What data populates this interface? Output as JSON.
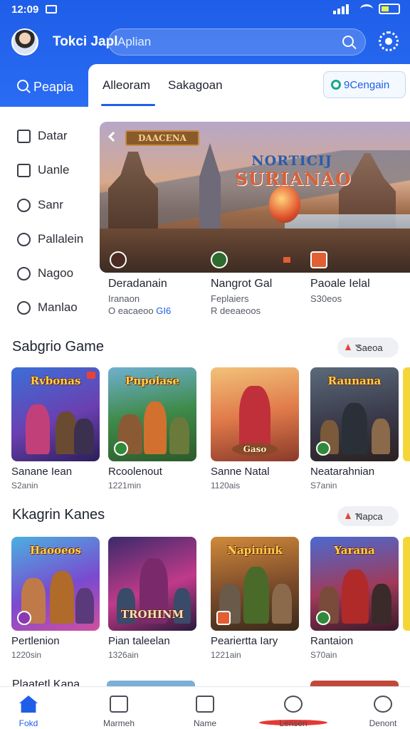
{
  "status_bar": {
    "time": "12:09"
  },
  "header": {
    "app_title": "Tokci Japl",
    "search_placeholder": "Aplian",
    "left_tab": "Peapia",
    "tabs": [
      {
        "label": "Alleoram"
      },
      {
        "label": "Sakagoan"
      }
    ],
    "tab_button": "9Cengain"
  },
  "sidebar": {
    "items": [
      {
        "label": "Datar",
        "icon": "grid-icon"
      },
      {
        "label": "Uanle",
        "icon": "frame-icon"
      },
      {
        "label": "Sanr",
        "icon": "search-icon"
      },
      {
        "label": "Pallalein",
        "icon": "edit-icon"
      },
      {
        "label": "Nagoo",
        "icon": "clock-icon"
      },
      {
        "label": "Manlao",
        "icon": "chat-icon"
      }
    ]
  },
  "featured": {
    "sign": "DAACENA",
    "logo_line1": "NORTICIJ",
    "logo_line2": "SURIANAO",
    "cards": [
      {
        "title": "Deradanain",
        "line1": "Iranaon",
        "line2": "O eacaeoo",
        "highlight": "GI6"
      },
      {
        "title": "Nangrot Gal",
        "line1": "Feplaiers",
        "line2": "R deeaeoos",
        "highlight": ""
      },
      {
        "title": "Paoale Ielal",
        "line1": "S30eos",
        "line2": "",
        "highlight": ""
      }
    ]
  },
  "sections": [
    {
      "title": "Sabgrio Game",
      "pill": "Saeoa",
      "games": [
        {
          "name": "Sanane Iean",
          "meta": "S2anin",
          "art": "Rvbonas"
        },
        {
          "name": "Rcoolenout",
          "meta": "1221min",
          "art": "Pnpolase"
        },
        {
          "name": "Sanne Natal",
          "meta": "1120ais",
          "art": "Gaso"
        },
        {
          "name": "Neatarahnian",
          "meta": "S7anin",
          "art": "Raunana"
        }
      ]
    },
    {
      "title": "Kkagrin Kanes",
      "pill": "Napca",
      "games": [
        {
          "name": "Pertlenion",
          "meta": "1220sin",
          "art": "Haooeos"
        },
        {
          "name": "Pian taleelan",
          "meta": "1326ain",
          "art": "TROHINM"
        },
        {
          "name": "Peariertta Iary",
          "meta": "1221ain",
          "art": "Napinink"
        },
        {
          "name": "Rantaion",
          "meta": "S70ain",
          "art": "Yarana"
        }
      ]
    }
  ],
  "partial_section_title": "Plaatetl Kana",
  "bottom_nav": [
    {
      "label": "Fokd",
      "icon": "home-icon",
      "active": true
    },
    {
      "label": "Marmeh",
      "icon": "cube-icon",
      "active": false
    },
    {
      "label": "Name",
      "icon": "map-icon",
      "active": false
    },
    {
      "label": "Lensen",
      "icon": "compass-icon",
      "active": false,
      "badge": "1"
    },
    {
      "label": "Denont",
      "icon": "profile-icon",
      "active": false
    }
  ],
  "colors": {
    "accent": "#1f5ee8",
    "highlight_green": "#1aa88a",
    "badge_red": "#e53935"
  }
}
